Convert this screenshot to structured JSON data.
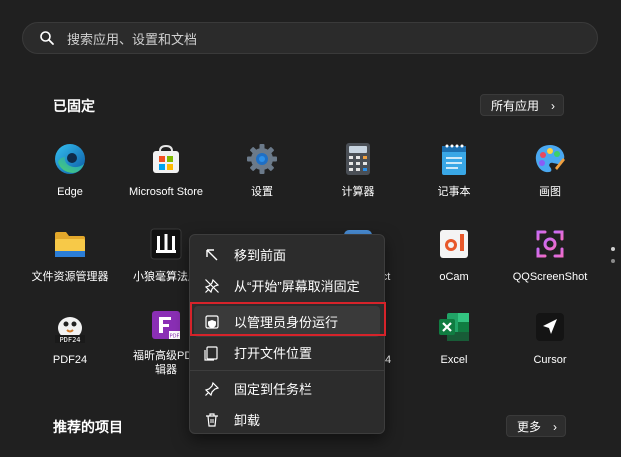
{
  "search": {
    "placeholder": "搜索应用、设置和文档"
  },
  "pinned": {
    "title": "已固定",
    "all_apps_label": "所有应用",
    "apps": [
      {
        "label": "Edge",
        "icon": "edge-icon"
      },
      {
        "label": "Microsoft Store",
        "icon": "store-icon"
      },
      {
        "label": "设置",
        "icon": "settings-gear-icon"
      },
      {
        "label": "计算器",
        "icon": "calculator-icon"
      },
      {
        "label": "记事本",
        "icon": "notepad-icon"
      },
      {
        "label": "画图",
        "icon": "paint-palette-icon"
      },
      {
        "label": "文件资源管理器",
        "icon": "folder-icon"
      },
      {
        "label": "小狼毫算法服",
        "icon": "xiaolanghao-icon"
      },
      {
        "label": "ct",
        "icon": "partial-app-icon"
      },
      {
        "label": "oCam",
        "icon": "ocam-icon"
      },
      {
        "label": "QQScreenShot",
        "icon": "qqscreenshot-icon"
      },
      {
        "label": "PDF24",
        "icon": "pdf24-icon"
      },
      {
        "label": "福昕高级PDF",
        "label2": "辑器",
        "icon": "foxit-pdf-icon"
      },
      {
        "label": "4",
        "icon": "partial-app-icon"
      },
      {
        "label": "Excel",
        "icon": "excel-icon"
      },
      {
        "label": "Cursor",
        "icon": "cursor-icon"
      }
    ]
  },
  "recommended": {
    "title": "推荐的项目",
    "more_label": "更多"
  },
  "context_menu": {
    "items": [
      {
        "label": "移到前面",
        "icon": "move-to-front-arrow-icon"
      },
      {
        "label": "从“开始”屏幕取消固定",
        "icon": "unpin-icon"
      },
      {
        "label": "以管理员身份运行",
        "icon": "shield-admin-icon"
      },
      {
        "label": "打开文件位置",
        "icon": "open-file-location-icon"
      },
      {
        "label": "固定到任务栏",
        "icon": "pin-icon"
      },
      {
        "label": "卸载",
        "icon": "trash-icon"
      }
    ]
  },
  "colors": {
    "background": "#202020",
    "highlight_border": "#d6232a",
    "menu_bg": "#2c2c2c"
  }
}
